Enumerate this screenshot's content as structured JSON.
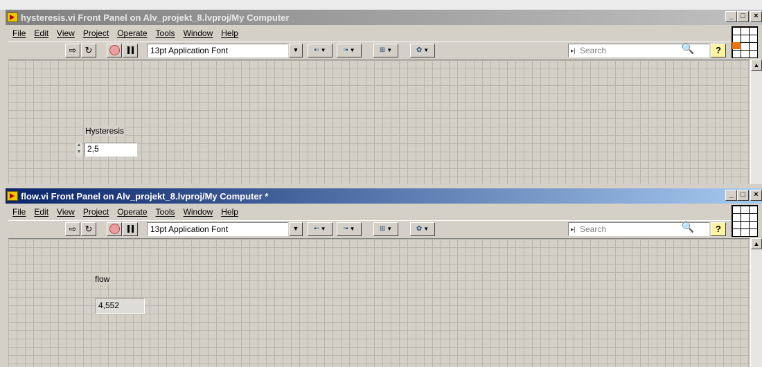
{
  "windows": [
    {
      "title": "hysteresis.vi Front Panel on Alv_projekt_8.lvproj/My Computer",
      "menu": [
        "File",
        "Edit",
        "View",
        "Project",
        "Operate",
        "Tools",
        "Window",
        "Help"
      ],
      "font_select": "13pt Application Font",
      "search_placeholder": "Search",
      "control": {
        "label": "Hysteresis",
        "value": "2,5"
      }
    },
    {
      "title": "flow.vi Front Panel on Alv_projekt_8.lvproj/My Computer *",
      "menu": [
        "File",
        "Edit",
        "View",
        "Project",
        "Operate",
        "Tools",
        "Window",
        "Help"
      ],
      "font_select": "13pt Application Font",
      "search_placeholder": "Search",
      "indicator": {
        "label": "flow",
        "value": "4,552"
      }
    }
  ],
  "window_buttons": {
    "minimize": "_",
    "maximize": "□",
    "close": "×"
  },
  "help_symbol": "?",
  "colors": {
    "active_title": "#0a246a",
    "inactive_title": "#808080",
    "panel_grid": "#b8b5ad"
  }
}
